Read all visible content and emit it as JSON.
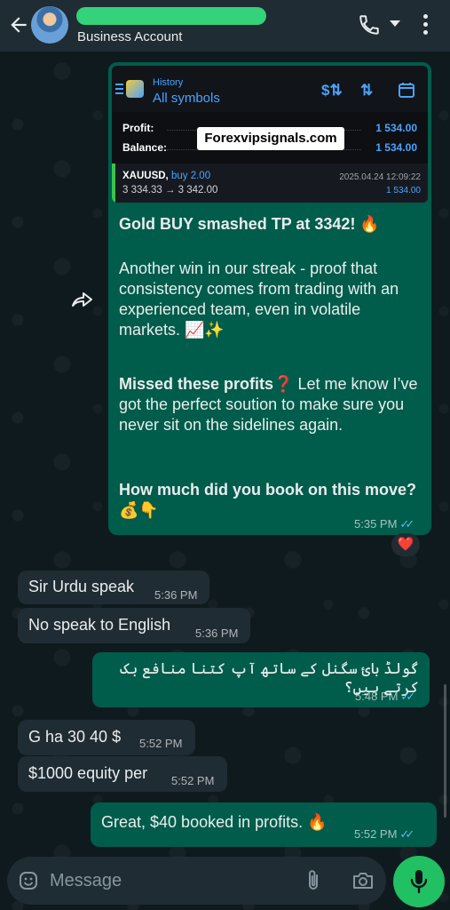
{
  "header": {
    "contact_subtitle": "Business Account",
    "accent_color": "#34d27a"
  },
  "forwarded_card": {
    "history_label": "History",
    "symbols_label": "All symbols",
    "profit_label": "Profit:",
    "profit_value": "1 534.00",
    "balance_label": "Balance:",
    "balance_value": "1 534.00",
    "watermark": "Forexvipsignals.com",
    "trade_symbol": "XAUUSD,",
    "trade_direction": "buy 2.00",
    "trade_prices": "3 334.33 → 3 342.00",
    "trade_datetime": "2025.04.24 12:09:22",
    "trade_profit": "1 534.00"
  },
  "messages": {
    "m1": {
      "headline": "Gold BUY smashed TP at 3342! 🔥",
      "para1": "Another win in our streak - proof that consistency comes from trading with an experienced team, even in volatile markets. 📈✨",
      "para2_bold": "Missed these profits❓",
      "para2_rest": " Let me know I’ve got the perfect soution to make sure you never sit on the sidelines again.",
      "question": "How much did you book on this move? 💰👇",
      "time": "5:35 PM",
      "reaction": "❤️"
    },
    "m2": {
      "text": "Sir Urdu speak",
      "time": "5:36 PM"
    },
    "m3": {
      "text": "No speak to English",
      "time": "5:36 PM"
    },
    "m4": {
      "text": "گولڈ بائ سگنل کے ساتھ آپ کتنا منافع بک کرتے ہیں؟",
      "time": "5:48 PM"
    },
    "m5": {
      "text": "G ha 30 40 $",
      "time": "5:52 PM"
    },
    "m6": {
      "text": "$1000 equity per",
      "time": "5:52 PM"
    },
    "m7": {
      "text": "Great, $40 booked in profits. 🔥",
      "time": "5:52 PM"
    }
  },
  "composer": {
    "placeholder": "Message"
  },
  "icons": {
    "back": "back-arrow-icon",
    "call": "phone-icon",
    "menu": "more-vert-icon",
    "forward": "forward-icon",
    "emoji": "emoji-icon",
    "attach": "paperclip-icon",
    "camera": "camera-icon",
    "mic": "mic-icon"
  }
}
